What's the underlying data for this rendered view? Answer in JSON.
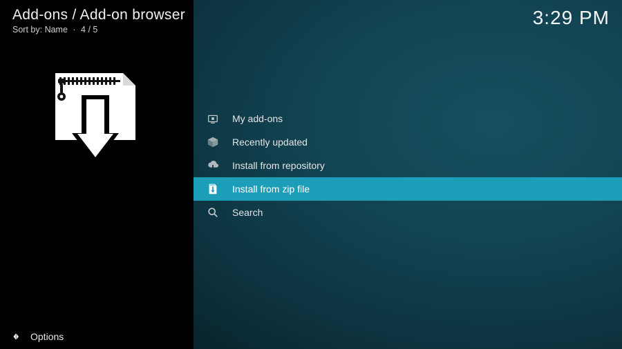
{
  "header": {
    "breadcrumb": "Add-ons / Add-on browser",
    "sort_label": "Sort by:",
    "sort_value": "Name",
    "position": "4 / 5"
  },
  "clock": "3:29 PM",
  "menu": {
    "items": [
      {
        "icon": "addons-icon",
        "label": "My add-ons",
        "selected": false
      },
      {
        "icon": "box-icon",
        "label": "Recently updated",
        "selected": false
      },
      {
        "icon": "cloud-icon",
        "label": "Install from repository",
        "selected": false
      },
      {
        "icon": "zip-icon",
        "label": "Install from zip file",
        "selected": true
      },
      {
        "icon": "search-icon",
        "label": "Search",
        "selected": false
      }
    ]
  },
  "footer": {
    "options_label": "Options"
  },
  "colors": {
    "accent": "#1d9eb8"
  }
}
